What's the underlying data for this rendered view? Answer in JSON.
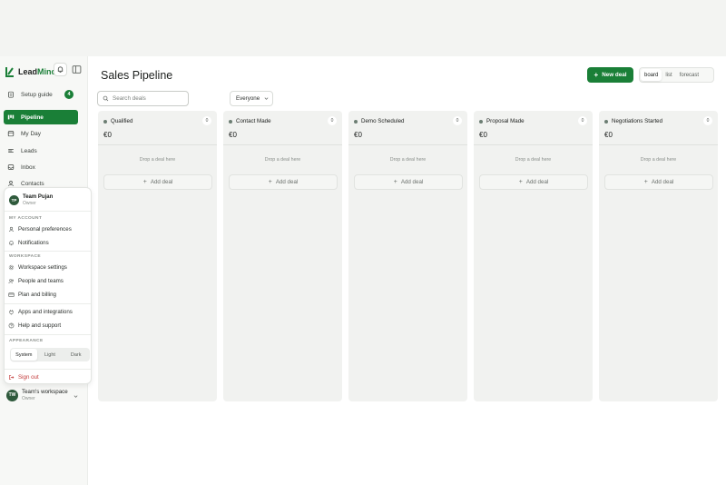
{
  "brand": {
    "name_a": "Lead",
    "name_b": "Mino"
  },
  "sidebar": {
    "items": [
      {
        "label": "Setup guide",
        "badge": "4"
      },
      {
        "label": "Pipeline"
      },
      {
        "label": "My Day"
      },
      {
        "label": "Leads"
      },
      {
        "label": "Inbox"
      },
      {
        "label": "Contacts"
      }
    ],
    "workspace": {
      "initials": "TW",
      "name": "Team's workspace",
      "role": "Owner"
    }
  },
  "account_menu": {
    "user": {
      "initials": "TP",
      "name": "Team Pujan",
      "role": "Owner"
    },
    "my_account_heading": "MY ACCOUNT",
    "personal_preferences": "Personal preferences",
    "notifications": "Notifications",
    "workspace_heading": "WORKSPACE",
    "workspace_settings": "Workspace settings",
    "people_and_teams": "People and teams",
    "plan_and_billing": "Plan and billing",
    "apps_and_integrations": "Apps and integrations",
    "help_and_support": "Help and support",
    "appearance_heading": "APPEARANCE",
    "appearance_options": [
      "System",
      "Light",
      "Dark"
    ],
    "appearance_selected": "System",
    "sign_out": "Sign out"
  },
  "header": {
    "title": "Sales Pipeline",
    "new_deal": "New deal",
    "views": [
      "board",
      "list",
      "forecast"
    ],
    "view_selected": "board"
  },
  "toolbar": {
    "search_placeholder": "Search deals",
    "filter_value": "Everyone"
  },
  "columns": [
    {
      "name": "Qualified",
      "count": "0",
      "total": "€0",
      "empty": "Drop a deal here",
      "add": "Add deal"
    },
    {
      "name": "Contact Made",
      "count": "0",
      "total": "€0",
      "empty": "Drop a deal here",
      "add": "Add deal"
    },
    {
      "name": "Demo Scheduled",
      "count": "0",
      "total": "€0",
      "empty": "Drop a deal here",
      "add": "Add deal"
    },
    {
      "name": "Proposal Made",
      "count": "0",
      "total": "€0",
      "empty": "Drop a deal here",
      "add": "Add deal"
    },
    {
      "name": "Negotiations Started",
      "count": "0",
      "total": "€0",
      "empty": "Drop a deal here",
      "add": "Add deal"
    }
  ],
  "colors": {
    "accent": "#1a7f37",
    "danger": "#c43d3d",
    "column_bg": "#f1f2f0"
  }
}
